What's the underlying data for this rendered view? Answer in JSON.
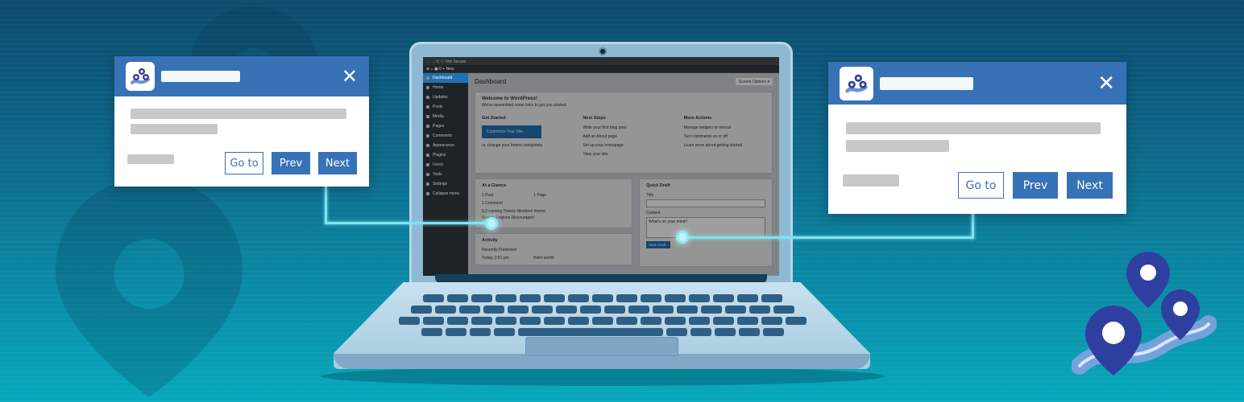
{
  "colors": {
    "background_top": "#0c4a6e",
    "background_bottom": "#07a9bd",
    "popup_accent": "#3771b6",
    "connector": "#7fe3f2",
    "wp_blue": "#2271b1"
  },
  "laptop_screen": {
    "browser_bar": "←  →  C   ⓘ  Not Secure",
    "admin_bar": "⊕  ⌂  ▣ 0  + New",
    "screen_options": "Screen Options ▾",
    "sidebar": [
      {
        "label": "Dashboard",
        "active": true
      },
      {
        "label": "Home",
        "active": false
      },
      {
        "label": "Updates",
        "active": false
      },
      {
        "label": "Posts",
        "active": false
      },
      {
        "label": "Media",
        "active": false
      },
      {
        "label": "Pages",
        "active": false
      },
      {
        "label": "Comments",
        "active": false
      },
      {
        "label": "Appearance",
        "active": false
      },
      {
        "label": "Plugins",
        "active": false
      },
      {
        "label": "Users",
        "active": false
      },
      {
        "label": "Tools",
        "active": false
      },
      {
        "label": "Settings",
        "active": false
      },
      {
        "label": "Collapse menu",
        "active": false
      }
    ],
    "page_title": "Dashboard",
    "welcome": {
      "title": "Welcome to WordPress!",
      "subtitle": "We've assembled some links to get you started:",
      "get_started": "Get Started",
      "customize_button": "Customize Your Site",
      "change_theme": "or, change your theme completely",
      "next_steps": "Next Steps",
      "next_steps_items": [
        "Write your first blog post",
        "Add an About page",
        "Set up your homepage",
        "View your site"
      ],
      "more_actions": "More Actions",
      "more_actions_items": [
        "Manage widgets or menus",
        "Turn comments on or off",
        "Learn more about getting started"
      ]
    },
    "glance": {
      "title": "At a Glance",
      "posts": "1 Post",
      "pages": "1 Page",
      "comments": "1 Comment",
      "running": "5.2 running Twenty Nineteen theme.",
      "search": "Search Engines Discouraged"
    },
    "activity": {
      "title": "Activity",
      "recently": "Recently Published",
      "time": "Today, 2:51 pm",
      "post": "Hello world!"
    },
    "quick_draft": {
      "title": "Quick Draft",
      "title_label": "Title",
      "content_label": "Content",
      "content_placeholder": "What's on your mind?",
      "save_button": "Save Draft"
    }
  },
  "popup_left": {
    "close": "✕",
    "goto_label": "Go to",
    "prev_label": "Prev",
    "next_label": "Next"
  },
  "popup_right": {
    "close": "✕",
    "goto_label": "Go to",
    "prev_label": "Prev",
    "next_label": "Next"
  }
}
